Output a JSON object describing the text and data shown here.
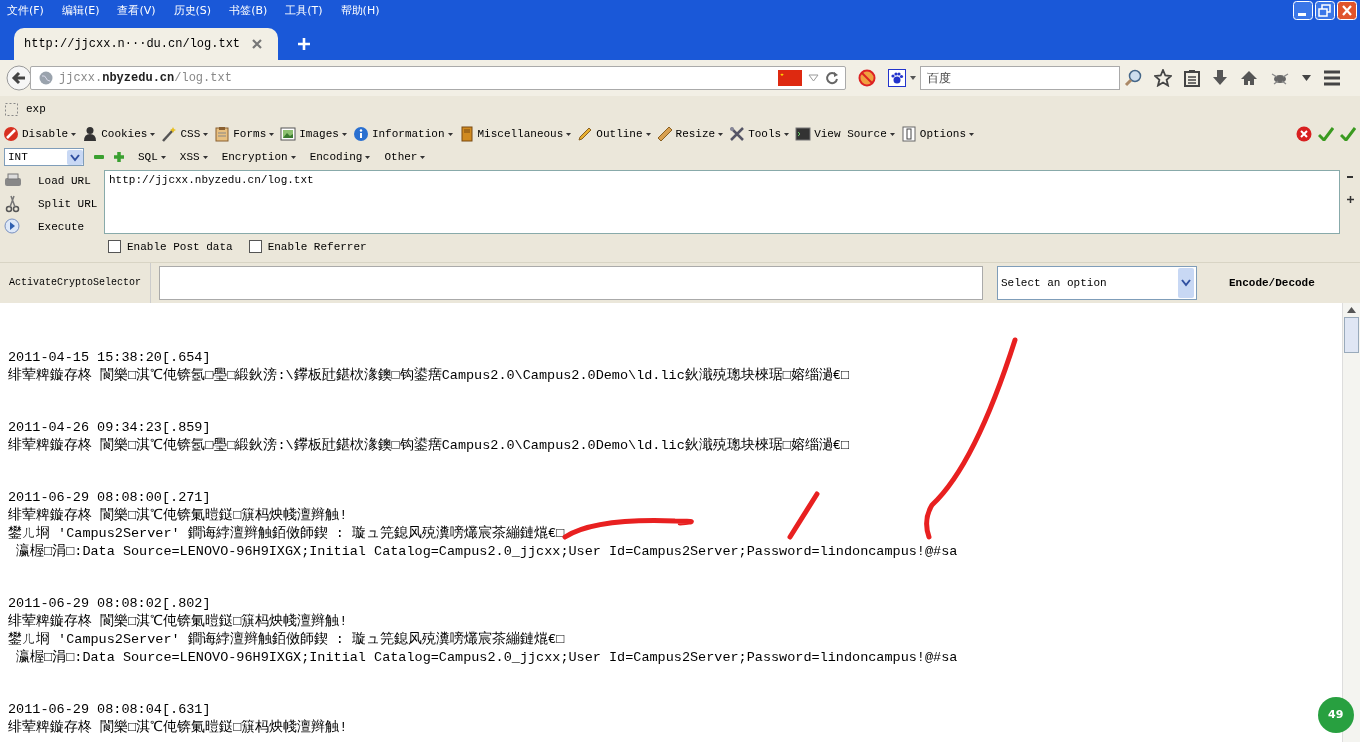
{
  "menu_bar": [
    "文件(F)",
    "编辑(E)",
    "查看(V)",
    "历史(S)",
    "书签(B)",
    "工具(T)",
    "帮助(H)"
  ],
  "tabs": [
    {
      "label": "http://jjcxx.n···du.cn/log.txt",
      "selected": true
    }
  ],
  "address_bar": {
    "url": "jjcxx.**nbyzedu.cn**/log.txt"
  },
  "search": {
    "placeholder": "百度"
  },
  "bookmarks": [
    "exp"
  ],
  "hackbar": {
    "menus": [
      "Disable",
      "Cookies",
      "CSS",
      "Forms",
      "Images",
      "Information",
      "Miscellaneous",
      "Outline",
      "Resize",
      "Tools",
      "View Source",
      "Options"
    ],
    "type_select": "INT",
    "submenus": [
      "SQL",
      "XSS",
      "Encryption",
      "Encoding",
      "Other"
    ],
    "actions": [
      "Load URL",
      "Split URL",
      "Execute"
    ],
    "url": "http://jjcxx.nbyzedu.cn/log.txt",
    "options": [
      {
        "label": "Enable Post data",
        "checked": false
      },
      {
        "label": "Enable Referrer",
        "checked": false
      }
    ],
    "crypto_button": "ActivateCryptoSelector",
    "crypto_select": "Select an option",
    "encode_button": "Encode/Decode"
  },
  "log": [
    {
      "time": "2011-04-15 15:38:20[.654]",
      "lines": [
        "绯荤粺鏇存柊 閬樂□淇℃伅锛氬□璺□緞鈥滂:\\鑻板瓧鍖栨湪鐭□钩鍙瘔Campus2.0\\Campus2.0Demo\\ld.lic鈥濈殑璁块棶琚□嫆缁濄€□"
      ]
    },
    {
      "time": "2011-04-26 09:34:23[.859]",
      "lines": [
        "绯荤粺鏇存柊 閬樂□淇℃伅锛氬□璺□緞鈥滂:\\鑻板瓧鍖栨湪鐭□钩鍙瘔Campus2.0\\Campus2.0Demo\\ld.lic鈥濈殑璁块棶琚□嫆缁濄€□"
      ]
    },
    {
      "time": "2011-06-29 08:08:00[.271]",
      "lines": [
        "绯荤粺鏇存柊 閬樂□淇℃伅锛氭暟鎹□簱杩炴帴澶辫触!",
        "鐢ㄦ埛 'Campus2Server' 鐧诲綍澶辫触銆傚師鍥 : 璇ュ笎鎴风殑瀵嗙爜宸茶繃鏈熴€□",
        " 瀛楃□涓□:Data Source=LENOVO-96H9IXGX;Initial Catalog=Campus2.0_jjcxx;User Id=Campus2Server;Password=lindoncampus!@#sa"
      ]
    },
    {
      "time": "2011-06-29 08:08:02[.802]",
      "lines": [
        "绯荤粺鏇存柊 閬樂□淇℃伅锛氭暟鎹□簱杩炴帴澶辫触!",
        "鐢ㄦ埛 'Campus2Server' 鐧诲綍澶辫触銆傚師鍥 : 璇ュ笎鎴风殑瀵嗙爜宸茶繃鏈熴€□",
        " 瀛楃□涓□:Data Source=LENOVO-96H9IXGX;Initial Catalog=Campus2.0_jjcxx;User Id=Campus2Server;Password=lindoncampus!@#sa"
      ]
    },
    {
      "time": "2011-06-29 08:08:04[.631]",
      "lines": [
        "绯荤粺鏇存柊 閬樂□淇℃伅锛氭暟鎹□簱杩炴帴澶辫触!"
      ]
    }
  ],
  "badge": "49"
}
